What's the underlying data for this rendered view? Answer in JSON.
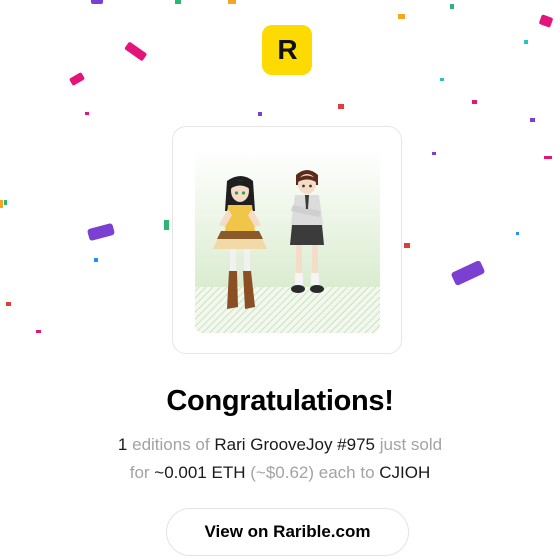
{
  "brand": {
    "logo_letter": "R",
    "logo_icon": "rarible-logo-icon",
    "logo_color": "#FEDA03"
  },
  "artwork": {
    "icon": "nft-artwork-image"
  },
  "heading": "Congratulations!",
  "sale": {
    "count": "1",
    "editions_text": "editions of",
    "item_name": "Rari GrooveJoy #975",
    "sold_text": "just sold",
    "for_text": "for",
    "price": "~0.001 ETH",
    "usd_price": "(~$0.62)",
    "each_to_text": "each to",
    "buyer": "CJIOH"
  },
  "cta_label": "View on Rarible.com",
  "colors": {
    "confetti": [
      "#e4157a",
      "#7b3fd1",
      "#2bb673",
      "#f5a623",
      "#1e90ff",
      "#e23b3b",
      "#27c4c4"
    ]
  }
}
